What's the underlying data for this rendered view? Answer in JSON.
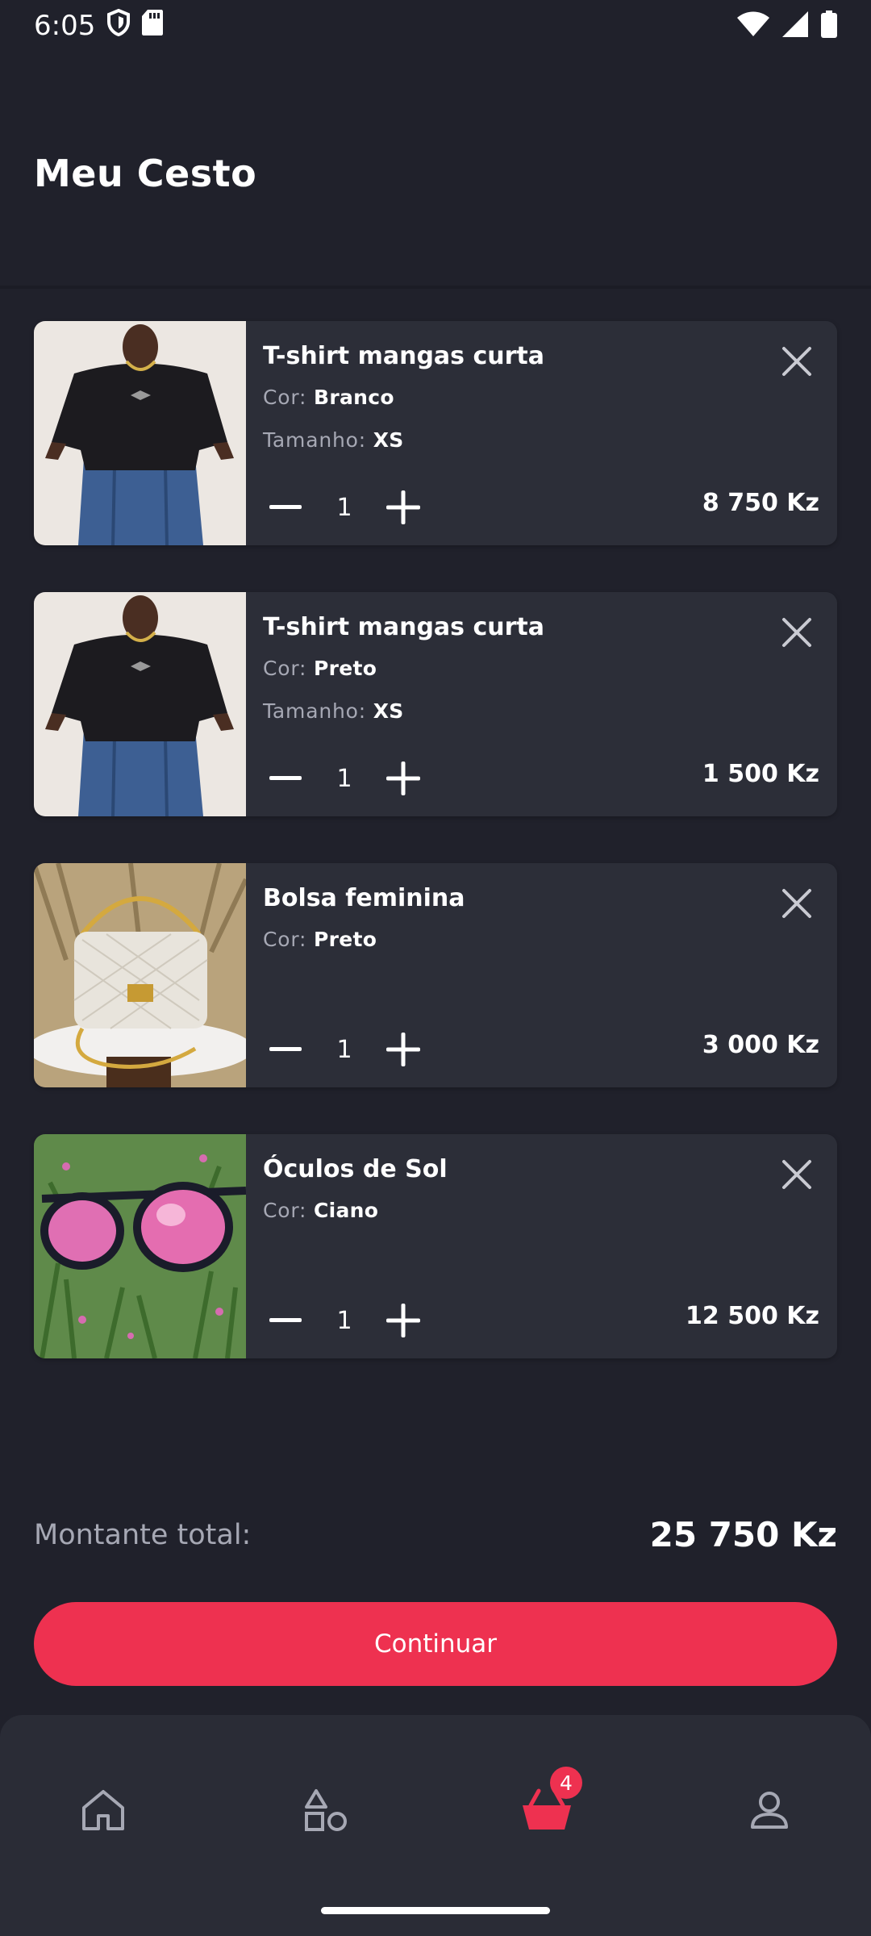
{
  "status_bar": {
    "time": "6:05",
    "icons_left": [
      "shield-icon",
      "sd-card-icon"
    ],
    "icons_right": [
      "wifi-icon",
      "signal-icon",
      "battery-icon"
    ]
  },
  "header": {
    "title": "Meu Cesto"
  },
  "cart": {
    "items": [
      {
        "name": "T-shirt mangas curta",
        "attr1_label": "Cor:",
        "attr1_value": "Branco",
        "attr2_label": "Tamanho:",
        "attr2_value": "XS",
        "quantity": "1",
        "price": "8 750 Kz",
        "image": "black-tshirt-photo"
      },
      {
        "name": "T-shirt mangas curta",
        "attr1_label": "Cor:",
        "attr1_value": "Preto",
        "attr2_label": "Tamanho:",
        "attr2_value": "XS",
        "quantity": "1",
        "price": "1 500 Kz",
        "image": "black-tshirt-photo"
      },
      {
        "name": "Bolsa feminina",
        "attr1_label": "Cor:",
        "attr1_value": "Preto",
        "quantity": "1",
        "price": "3 000 Kz",
        "image": "white-handbag-photo"
      },
      {
        "name": "Óculos de Sol",
        "attr1_label": "Cor:",
        "attr1_value": "Ciano",
        "quantity": "1",
        "price": "12 500 Kz",
        "image": "sunglasses-photo"
      }
    ]
  },
  "summary": {
    "total_label": "Montante total:",
    "total_value": "25 750 Kz"
  },
  "actions": {
    "continue_label": "Continuar"
  },
  "bottom_nav": {
    "items": [
      {
        "name": "home",
        "icon": "home-icon"
      },
      {
        "name": "categories",
        "icon": "shapes-icon"
      },
      {
        "name": "cart",
        "icon": "basket-icon",
        "badge": "4",
        "active": true
      },
      {
        "name": "profile",
        "icon": "user-icon"
      }
    ]
  },
  "colors": {
    "background": "#20212b",
    "card": "#2c2e38",
    "accent": "#ee3150",
    "muted_text": "#a6a8b4",
    "nav_inactive": "#a6a8b4"
  }
}
